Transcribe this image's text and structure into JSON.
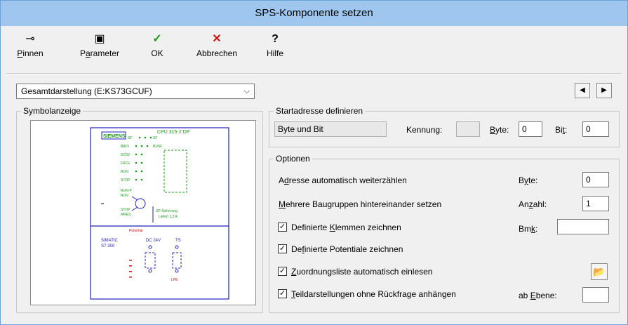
{
  "window": {
    "title": "SPS-Komponente setzen"
  },
  "toolbar": {
    "pin": {
      "label": "Pinnen",
      "icon": "pin-icon"
    },
    "params": {
      "label": "Parameter",
      "icon": "properties-icon"
    },
    "ok": {
      "label": "OK",
      "icon": "checkmark-icon",
      "color": "#1a9a1a"
    },
    "cancel": {
      "label": "Abbrechen",
      "icon": "cross-icon",
      "color": "#d01010"
    },
    "help": {
      "label": "Hilfe",
      "icon": "help-icon"
    }
  },
  "combo": {
    "value": "Gesamtdarstellung  (E:KS73GCUF)"
  },
  "symbol": {
    "title": "Symbolanzeige"
  },
  "startaddr": {
    "title": "Startadresse definieren",
    "mode_value": "Byte und Bit",
    "kennung_label": "Kennung:",
    "kennung_value": "",
    "byte_label": "Byte:",
    "byte_value": "0",
    "bit_label": "Bit:",
    "bit_value": "0"
  },
  "options": {
    "title": "Optionen",
    "auto_count_label": "Adresse automatisch weiterzählen",
    "multi_label": "Mehrere Baugruppen hintereinander setzen",
    "byte_label": "Byte:",
    "byte_value": "0",
    "anzahl_label": "Anzahl:",
    "anzahl_value": "1",
    "bmk_label": "Bmk:",
    "bmk_value": "",
    "ebene_label": "ab Ebene:",
    "ebene_value": "",
    "checks": [
      {
        "label": "Definierte Klemmen zeichnen",
        "checked": true
      },
      {
        "label": "Definierte Potentiale zeichnen",
        "checked": true
      },
      {
        "label": "Zuordnungsliste automatisch einlesen",
        "checked": true
      },
      {
        "label": "Teildarstellungen ohne Rückfrage anhängen",
        "checked": true
      }
    ]
  },
  "diagram": {
    "brand": "SIEMENS",
    "cpu": "CPU 315-2 DP",
    "leds": [
      "SF",
      "BATF",
      "DC5V",
      "FRCE",
      "RUN",
      "STOP"
    ],
    "leds_right": [
      "SF",
      "BUSF"
    ],
    "run_p": "RUN-P",
    "run": "RUN",
    "stop": "STOP",
    "mres": "MRES",
    "sp_label": "SP-Sicherung",
    "sp_label2": "Liefert 1,2 A",
    "simatic": "SIMATIC",
    "s7": "S7-300",
    "dc24": "DC 24V",
    "ts": "TS",
    "red1": "Potential",
    "red2": "LPE"
  }
}
